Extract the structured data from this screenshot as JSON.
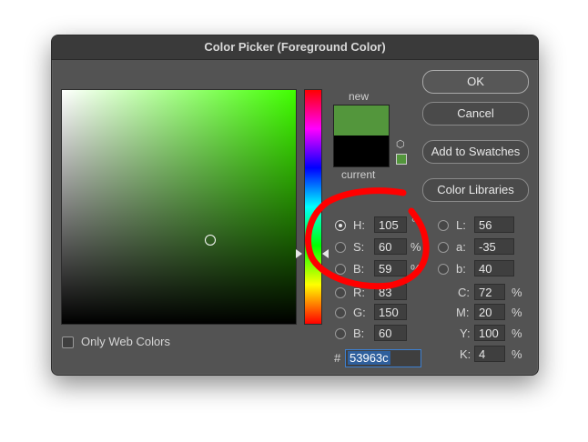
{
  "window": {
    "title": "Color Picker (Foreground Color)"
  },
  "swatches": {
    "new_label": "new",
    "current_label": "current",
    "new_color": "#53963c",
    "current_color": "#000000"
  },
  "buttons": {
    "ok": "OK",
    "cancel": "Cancel",
    "add_to_swatches": "Add to Swatches",
    "color_libraries": "Color Libraries"
  },
  "hsb": {
    "h": {
      "label": "H:",
      "value": "105",
      "unit": "°"
    },
    "s": {
      "label": "S:",
      "value": "60",
      "unit": "%"
    },
    "b": {
      "label": "B:",
      "value": "59",
      "unit": "%"
    }
  },
  "rgb": {
    "r": {
      "label": "R:",
      "value": "83"
    },
    "g": {
      "label": "G:",
      "value": "150"
    },
    "b": {
      "label": "B:",
      "value": "60"
    }
  },
  "lab": {
    "l": {
      "label": "L:",
      "value": "56"
    },
    "a": {
      "label": "a:",
      "value": "-35"
    },
    "b": {
      "label": "b:",
      "value": "40"
    }
  },
  "cmyk": {
    "c": {
      "label": "C:",
      "value": "72",
      "unit": "%"
    },
    "m": {
      "label": "M:",
      "value": "20",
      "unit": "%"
    },
    "y": {
      "label": "Y:",
      "value": "100",
      "unit": "%"
    },
    "k": {
      "label": "K:",
      "value": "4",
      "unit": "%"
    }
  },
  "hex": {
    "label": "#",
    "value": "53963c"
  },
  "options": {
    "only_web_colors": "Only Web Colors"
  },
  "colors": {
    "dialog_bg": "#535353",
    "annotation": "#ff0000",
    "selection": "#3d80d1"
  }
}
